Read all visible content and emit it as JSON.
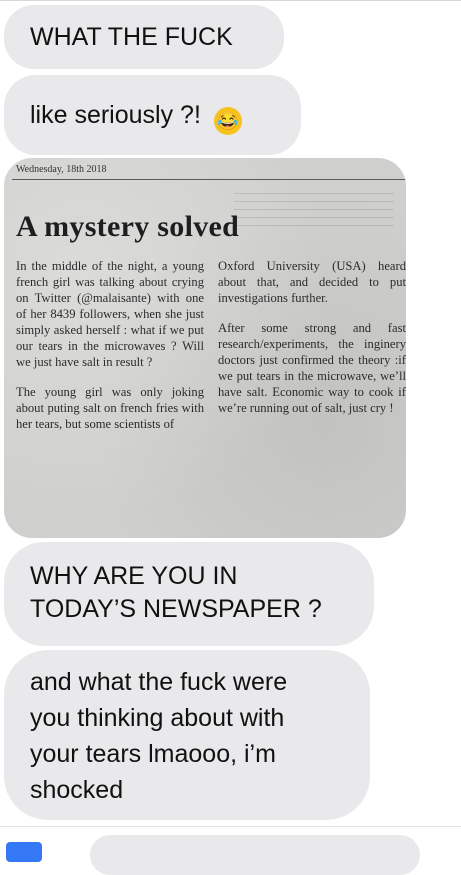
{
  "messages": {
    "m1": "WHAT THE FUCK",
    "m2": "like seriously ?!",
    "m2_emoji": "😂",
    "m4_line1": "WHY ARE YOU IN",
    "m4_line2": "TODAY’S NEWSPAPER ?",
    "m5_line1": "and what the fuck were",
    "m5_line2": "you thinking about with",
    "m5_line3": "your tears lmaooo, i’m",
    "m5_line4": "shocked"
  },
  "newspaper": {
    "date": "Wednesday, 18th 2018",
    "headline": "A mystery solved",
    "left_p1": "In the middle of the night, a young french girl was talking about crying on Twitter (@malaisante) with one of her 8439 followers, when she just simply asked herself : what if we put our tears in the microwaves ? Will we just have salt in result ?",
    "left_p2": "The young girl was only joking about puting salt on french fries with her tears, but some scientists of",
    "right_p1": "Oxford University (USA) heard about that, and decided to put investigations further.",
    "right_p2": "After some strong and fast research/experiments, the inginery doctors just confirmed the theory :if we put tears in the microwave, we’ll have salt. Economic way to cook if we’re running out of salt, just cry !"
  }
}
